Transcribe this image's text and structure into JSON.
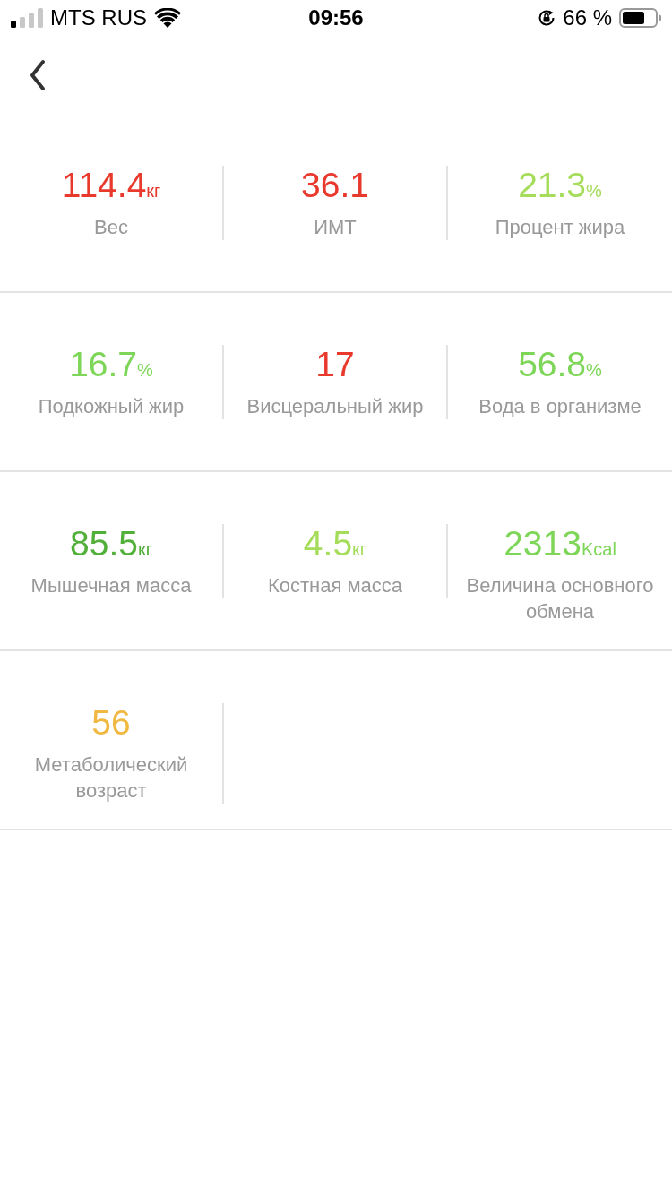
{
  "status_bar": {
    "carrier": "MTS RUS",
    "time": "09:56",
    "battery": "66 %"
  },
  "metrics": [
    {
      "value": "114.4",
      "unit": "кг",
      "label": "Вес",
      "color": "#e8392c"
    },
    {
      "value": "36.1",
      "label": "ИМТ",
      "color": "#e8392c"
    },
    {
      "value": "21.3",
      "unit": "%",
      "label": "Процент жира",
      "color": "#a5dc5a"
    },
    {
      "value": "16.7",
      "unit": "%",
      "label": "Подкожный жир",
      "color": "#7dd657"
    },
    {
      "value": "17",
      "label": "Висцеральный жир",
      "color": "#e8392c"
    },
    {
      "value": "56.8",
      "unit": "%",
      "label": "Вода в организме",
      "color": "#7dd657"
    },
    {
      "value": "85.5",
      "unit": "кг",
      "label": "Мышечная масса",
      "color": "#52b03a"
    },
    {
      "value": "4.5",
      "unit": "кг",
      "label": "Костная масса",
      "color": "#a5dc5a"
    },
    {
      "value": "2313",
      "unit": "Kcal",
      "label": "Величина основного обмена",
      "color": "#7dd657"
    },
    {
      "value": "56",
      "label": "Метаболический возраст",
      "color": "#f0b840"
    }
  ]
}
